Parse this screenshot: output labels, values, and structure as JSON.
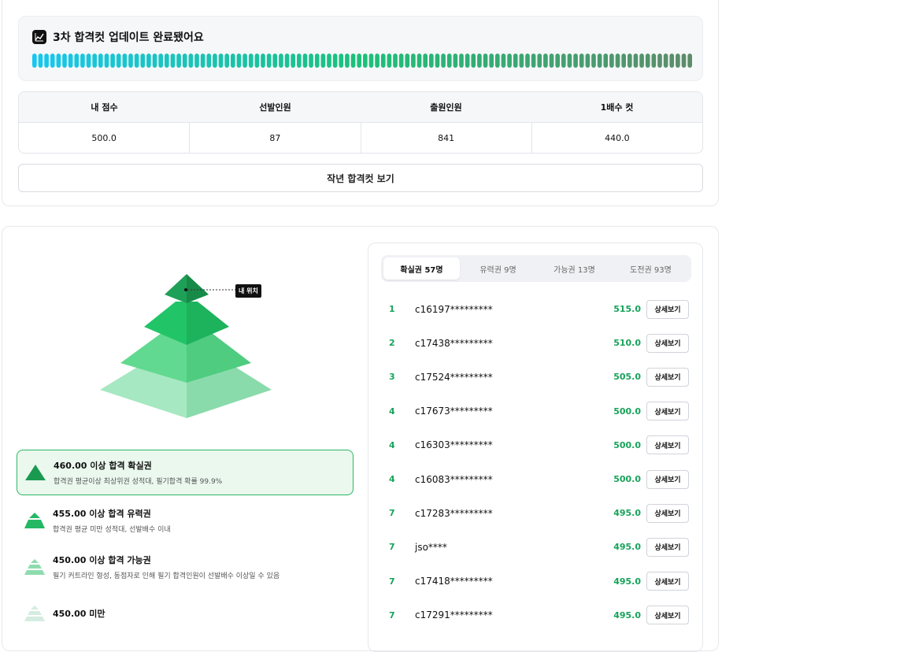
{
  "banner": {
    "title": "3차 합격컷 업데이트 완료됐어요",
    "icon": "line-chart-icon",
    "progress_gradient": [
      "#16c8ef",
      "#1cc07a",
      "#5d8c6a"
    ],
    "progress": 1.0
  },
  "stats": {
    "headers": [
      "내 점수",
      "선발인원",
      "출원인원",
      "1배수 컷"
    ],
    "values": [
      "500.0",
      "87",
      "841",
      "440.0"
    ]
  },
  "last_year_button": "작년 합격컷 보기",
  "pyramid": {
    "my_position_label": "내 위치",
    "colors": [
      "#1f9e55",
      "#22c468",
      "#62d990",
      "#a6e8c1"
    ]
  },
  "legend": [
    {
      "title": "460.00 이상 합격 확실권",
      "desc": "합격권 평균이상 최상위권 성적대, 필기합격 확률 99.9%",
      "active": true,
      "color": "#1a9a50"
    },
    {
      "title": "455.00 이상 합격 유력권",
      "desc": "합격권 평균 미만 성적대, 선발배수 이내",
      "active": false,
      "color": "#24b864"
    },
    {
      "title": "450.00 이상 합격 가능권",
      "desc": "필기 커트라인 형성, 동점자로 인해 필기 합격인원이 선발배수 이상일 수 있음",
      "active": false,
      "color": "#8edcae"
    },
    {
      "title": "450.00 미만",
      "desc": "",
      "active": false,
      "color": "#d4ede0"
    }
  ],
  "tabs": [
    {
      "label": "확실권 57명",
      "active": true
    },
    {
      "label": "유력권 9명",
      "active": false
    },
    {
      "label": "가능권 13명",
      "active": false
    },
    {
      "label": "도전권 93명",
      "active": false
    }
  ],
  "ranking": {
    "detail_label": "상세보기",
    "rows": [
      {
        "rank": "1",
        "id": "c16197*********",
        "score": "515.0"
      },
      {
        "rank": "2",
        "id": "c17438*********",
        "score": "510.0"
      },
      {
        "rank": "3",
        "id": "c17524*********",
        "score": "505.0"
      },
      {
        "rank": "4",
        "id": "c17673*********",
        "score": "500.0"
      },
      {
        "rank": "4",
        "id": "c16303*********",
        "score": "500.0"
      },
      {
        "rank": "4",
        "id": "c16083*********",
        "score": "500.0"
      },
      {
        "rank": "7",
        "id": "c17283*********",
        "score": "495.0"
      },
      {
        "rank": "7",
        "id": "jso****",
        "score": "495.0"
      },
      {
        "rank": "7",
        "id": "c17418*********",
        "score": "495.0"
      },
      {
        "rank": "7",
        "id": "c17291*********",
        "score": "495.0"
      }
    ]
  }
}
